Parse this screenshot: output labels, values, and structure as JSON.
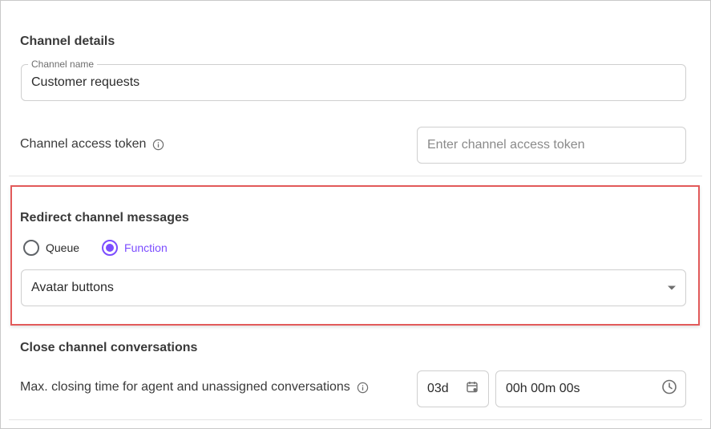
{
  "channel_details": {
    "title": "Channel details",
    "channel_name": {
      "label": "Channel name",
      "value": "Customer requests"
    }
  },
  "access_token": {
    "label": "Channel access token",
    "placeholder": "Enter channel access token",
    "info_icon": "info-icon"
  },
  "redirect": {
    "title": "Redirect channel messages",
    "options": [
      {
        "label": "Queue",
        "selected": false
      },
      {
        "label": "Function",
        "selected": true
      }
    ],
    "dropdown_value": "Avatar buttons",
    "highlight_color": "#e25a5a"
  },
  "close_conversations": {
    "title": "Close channel conversations",
    "label": "Max. closing time for agent and unassigned conversations",
    "days_value": "03d",
    "time_value": "00h 00m 00s",
    "calendar_icon": "calendar-icon",
    "clock_icon": "clock-icon"
  },
  "colors": {
    "accent": "#7c4dff",
    "border": "#cfcfcf",
    "text": "#2b2b2b"
  }
}
